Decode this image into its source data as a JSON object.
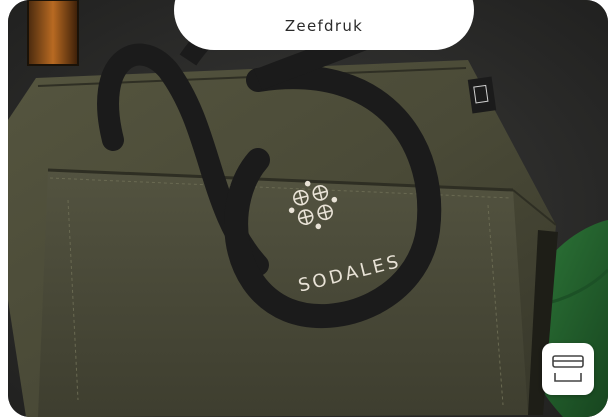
{
  "tab": {
    "label": "Zeefdruk"
  },
  "product": {
    "brand_text": "SODALES"
  },
  "action_button": {
    "icon": "print-side-icon"
  },
  "colors": {
    "bag": "#4a4a36",
    "tab_background": "#ffffff",
    "logo_print": "#e8e2d6"
  }
}
